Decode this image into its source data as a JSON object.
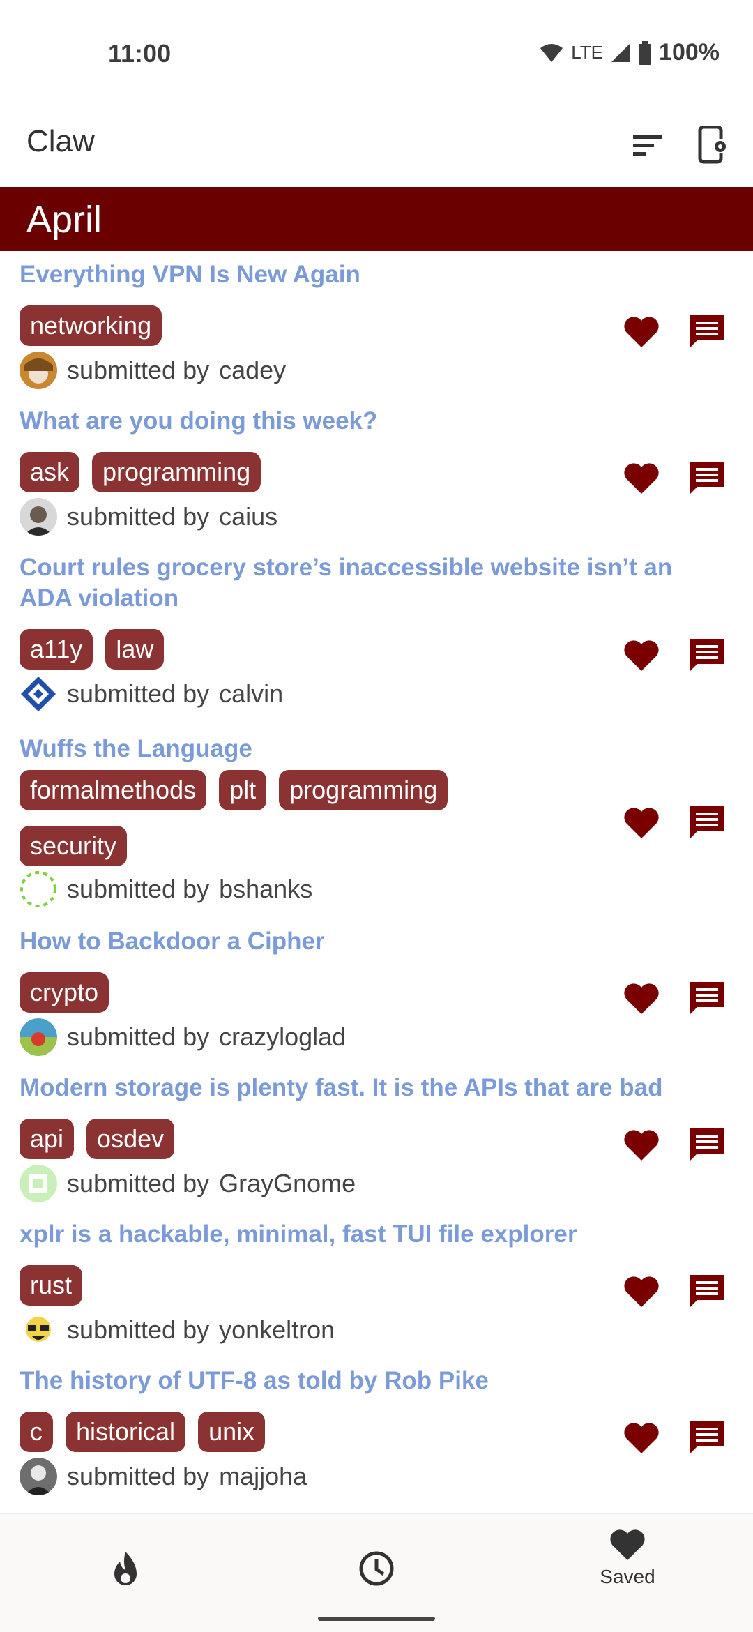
{
  "status": {
    "time": "11:00",
    "network": "LTE",
    "battery": "100%"
  },
  "app": {
    "title": "Claw"
  },
  "section": {
    "title": "April"
  },
  "user_prefix": "submitted by",
  "posts": [
    {
      "title": "Everything VPN Is New Again",
      "tags": [
        "networking"
      ],
      "user": "cadey"
    },
    {
      "title": "What are you doing this week?",
      "tags": [
        "ask",
        "programming"
      ],
      "user": "caius"
    },
    {
      "title": "Court rules grocery store’s inaccessible website isn’t an ADA violation",
      "tags": [
        "a11y",
        "law"
      ],
      "user": "calvin"
    },
    {
      "title": "Wuffs the Language",
      "tags": [
        "formalmethods",
        "plt",
        "programming",
        "security"
      ],
      "user": "bshanks"
    },
    {
      "title": "How to Backdoor a Cipher",
      "tags": [
        "crypto"
      ],
      "user": "crazyloglad"
    },
    {
      "title": "Modern storage is plenty fast. It is the APIs that are bad",
      "tags": [
        "api",
        "osdev"
      ],
      "user": "GrayGnome"
    },
    {
      "title": "xplr is a hackable, minimal, fast TUI file explorer",
      "tags": [
        "rust"
      ],
      "user": "yonkeltron"
    },
    {
      "title": "The history of UTF-8 as told by Rob Pike",
      "tags": [
        "c",
        "historical",
        "unix"
      ],
      "user": "majjoha"
    }
  ],
  "bottom_nav": {
    "saved_label": "Saved"
  },
  "colors": {
    "header": "#6b0000",
    "tag": "#8b3232",
    "link": "#7a9ad8",
    "icon": "#7a0000"
  }
}
